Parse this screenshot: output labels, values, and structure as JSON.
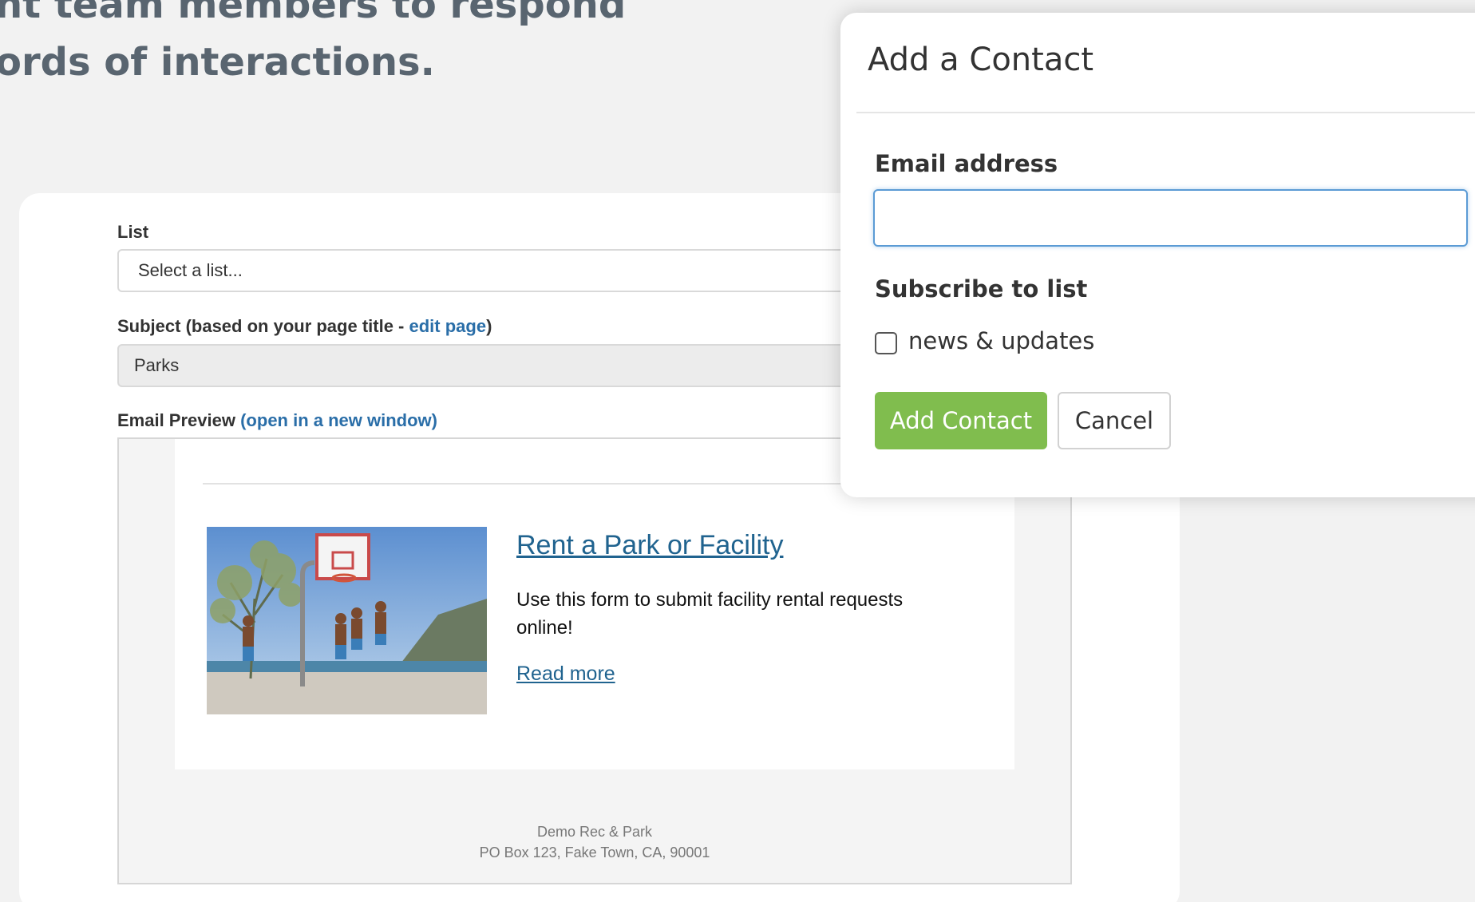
{
  "background": {
    "headline_lines": [
      "nt team members to respond",
      "ords of interactions."
    ]
  },
  "form": {
    "list_label": "List",
    "list_value": "Select a list...",
    "subject_label_prefix": "Subject (based on your page title - ",
    "subject_edit_link": "edit page",
    "subject_label_suffix": ")",
    "subject_value": "Parks",
    "preview_label": "Email Preview",
    "preview_open_link": "(open in a new window)"
  },
  "email_preview": {
    "item_title": "Rent a Park or Facility",
    "item_description": "Use this form to submit facility rental requests online!",
    "read_more": "Read more",
    "image_icon": "basketball-court-photo",
    "footer_org": "Demo Rec & Park",
    "footer_address": "PO Box 123, Fake Town, CA, 90001"
  },
  "modal": {
    "title": "Add a Contact",
    "email_label": "Email address",
    "email_value": "",
    "subscribe_label": "Subscribe to list",
    "list_option": "news & updates",
    "list_option_checked": false,
    "add_button": "Add Contact",
    "cancel_button": "Cancel"
  },
  "colors": {
    "primary_button": "#80bd4e",
    "link": "#2a6ea8",
    "focus_border": "#5b9bd5"
  }
}
